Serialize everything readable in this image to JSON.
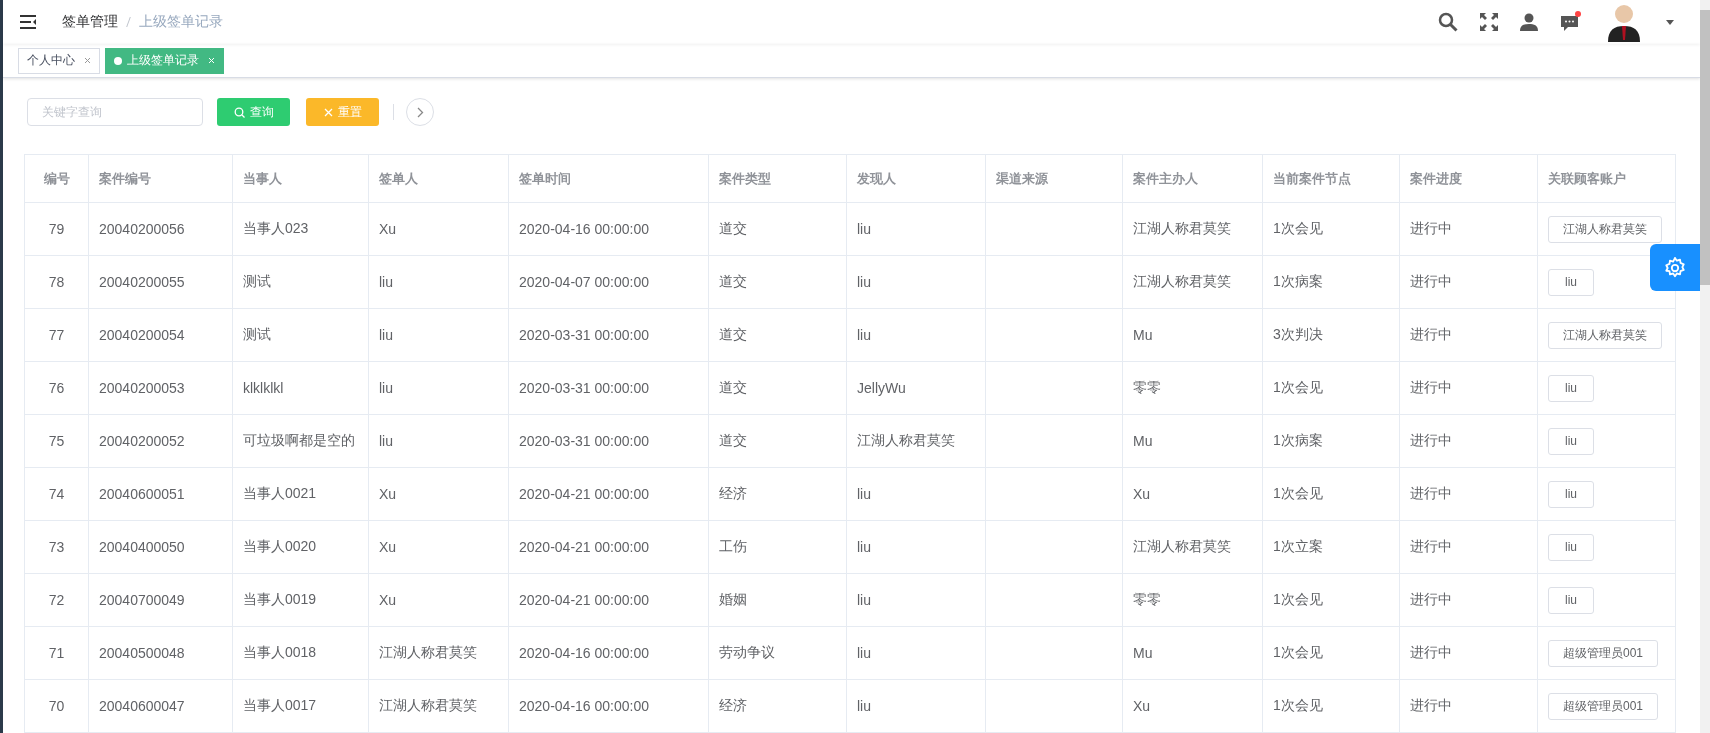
{
  "breadcrumb": [
    {
      "label": "签单管理"
    },
    {
      "label": "上级签单记录"
    }
  ],
  "header": {
    "has_notification": true
  },
  "tabs": [
    {
      "label": "个人中心",
      "selected": false
    },
    {
      "label": "上级签单记录",
      "selected": true
    }
  ],
  "search": {
    "placeholder": "关键字查询"
  },
  "buttons": [
    {
      "label": "查询",
      "kind": "search"
    },
    {
      "label": "重置",
      "kind": "reset"
    }
  ],
  "table": {
    "columns": [
      "编号",
      "案件编号",
      "当事人",
      "签单人",
      "签单时间",
      "案件类型",
      "发现人",
      "渠道来源",
      "案件主办人",
      "当前案件节点",
      "案件进度",
      "关联顾客账户"
    ],
    "rows": [
      [
        "79",
        "20040200056",
        "当事人023",
        "Xu",
        "2020-04-16 00:00:00",
        "道交",
        "liu",
        "",
        "江湖人称君莫笑",
        "1次会见",
        "进行中",
        "江湖人称君莫笑"
      ],
      [
        "78",
        "20040200055",
        "测试",
        "liu",
        "2020-04-07 00:00:00",
        "道交",
        "liu",
        "",
        "江湖人称君莫笑",
        "1次病案",
        "进行中",
        "liu"
      ],
      [
        "77",
        "20040200054",
        "测试",
        "liu",
        "2020-03-31 00:00:00",
        "道交",
        "liu",
        "",
        "Mu",
        "3次判决",
        "进行中",
        "江湖人称君莫笑"
      ],
      [
        "76",
        "20040200053",
        "klklklkl",
        "liu",
        "2020-03-31 00:00:00",
        "道交",
        "JellyWu",
        "",
        "零零",
        "1次会见",
        "进行中",
        "liu"
      ],
      [
        "75",
        "20040200052",
        "可垃圾啊都是空的",
        "liu",
        "2020-03-31 00:00:00",
        "道交",
        "江湖人称君莫笑",
        "",
        "Mu",
        "1次病案",
        "进行中",
        "liu"
      ],
      [
        "74",
        "20040600051",
        "当事人0021",
        "Xu",
        "2020-04-21 00:00:00",
        "经济",
        "liu",
        "",
        "Xu",
        "1次会见",
        "进行中",
        "liu"
      ],
      [
        "73",
        "20040400050",
        "当事人0020",
        "Xu",
        "2020-04-21 00:00:00",
        "工伤",
        "liu",
        "",
        "江湖人称君莫笑",
        "1次立案",
        "进行中",
        "liu"
      ],
      [
        "72",
        "20040700049",
        "当事人0019",
        "Xu",
        "2020-04-21 00:00:00",
        "婚姻",
        "liu",
        "",
        "零零",
        "1次会见",
        "进行中",
        "liu"
      ],
      [
        "71",
        "20040500048",
        "当事人0018",
        "江湖人称君莫笑",
        "2020-04-16 00:00:00",
        "劳动争议",
        "liu",
        "",
        "Mu",
        "1次会见",
        "进行中",
        "超级管理员001"
      ],
      [
        "70",
        "20040600047",
        "当事人0017",
        "江湖人称君莫笑",
        "2020-04-16 00:00:00",
        "经济",
        "liu",
        "",
        "Xu",
        "1次会见",
        "进行中",
        "超级管理员001"
      ]
    ]
  }
}
